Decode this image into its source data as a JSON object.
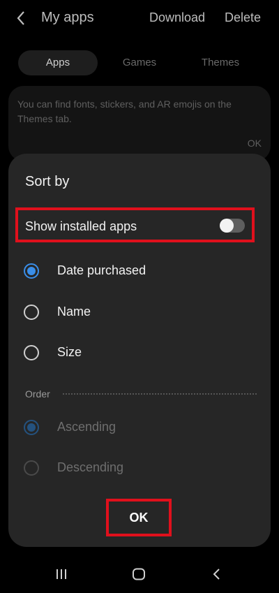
{
  "header": {
    "title": "My apps",
    "download_label": "Download",
    "delete_label": "Delete",
    "back_icon": "chevron-left-icon"
  },
  "tabs": [
    {
      "label": "Apps",
      "active": true
    },
    {
      "label": "Games",
      "active": false
    },
    {
      "label": "Themes",
      "active": false
    }
  ],
  "info_card": {
    "message": "You can find fonts, stickers, and AR emojis on the Themes tab.",
    "ok_label": "OK"
  },
  "sort_sheet": {
    "title": "Sort by",
    "show_installed": {
      "label": "Show installed apps",
      "enabled": false
    },
    "sort_options": [
      {
        "label": "Date purchased",
        "selected": true
      },
      {
        "label": "Name",
        "selected": false
      },
      {
        "label": "Size",
        "selected": false
      }
    ],
    "order_label": "Order",
    "order_options": [
      {
        "label": "Ascending",
        "selected": true,
        "disabled": true
      },
      {
        "label": "Descending",
        "selected": false,
        "disabled": true
      }
    ],
    "ok_label": "OK"
  },
  "highlight_color": "#e0101c",
  "accent_color": "#3a8ee8",
  "navbar": {
    "icons": [
      "recent-apps-icon",
      "home-icon",
      "back-icon"
    ]
  }
}
